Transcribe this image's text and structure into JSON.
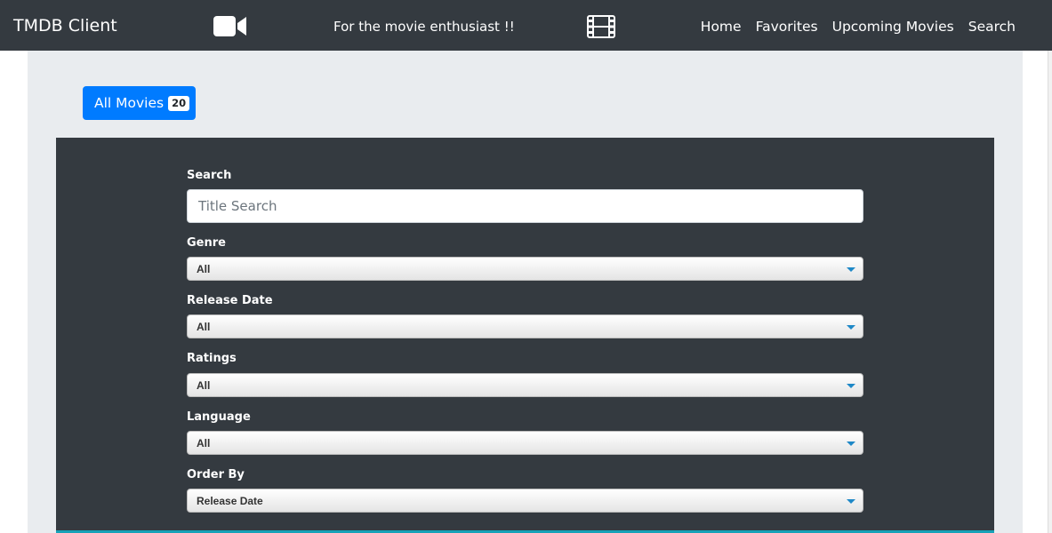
{
  "navbar": {
    "brand": "TMDB Client",
    "tagline": "For the movie enthusiast !!",
    "camera_icon": "video-camera-icon",
    "film_icon": "film-strip-icon",
    "links": [
      "Home",
      "Favorites",
      "Upcoming Movies",
      "Search"
    ]
  },
  "all_movies": {
    "label": "All Movies",
    "count": "20"
  },
  "filters": {
    "search": {
      "label": "Search",
      "placeholder": "Title Search",
      "value": ""
    },
    "genre": {
      "label": "Genre",
      "value": "All"
    },
    "release_date": {
      "label": "Release Date",
      "value": "All"
    },
    "ratings": {
      "label": "Ratings",
      "value": "All"
    },
    "language": {
      "label": "Language",
      "value": "All"
    },
    "order_by": {
      "label": "Order By",
      "value": "Release Date"
    }
  },
  "colors": {
    "navbar": "#343a40",
    "primary": "#007bff",
    "jumbotron": "#e9ecef",
    "panel": "#343a40",
    "accent_strip": "#17a2b8",
    "select_arrow": "#1e88c7"
  }
}
